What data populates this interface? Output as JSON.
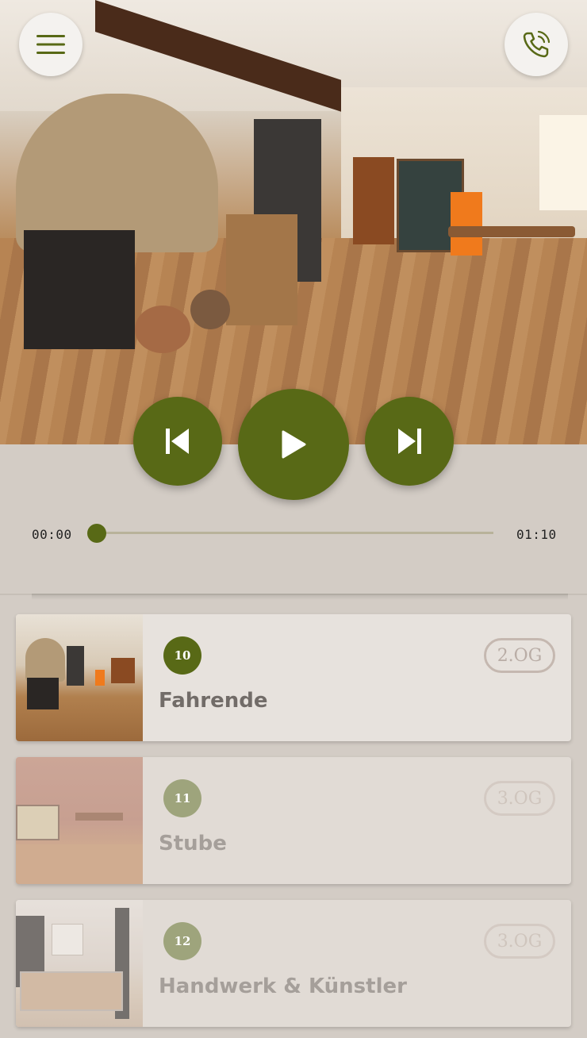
{
  "player": {
    "current_time": "00:00",
    "total_time": "01:10",
    "progress_fraction": 0.0
  },
  "stations": [
    {
      "number": "10",
      "title": "Fahrende",
      "floor": "2.OG",
      "active": true
    },
    {
      "number": "11",
      "title": "Stube",
      "floor": "3.OG",
      "active": false
    },
    {
      "number": "12",
      "title": "Handwerk & Künstler",
      "floor": "3.OG",
      "active": false
    }
  ],
  "colors": {
    "accent": "#586916",
    "accent_muted": "#9ea47c",
    "background": "#d3ccc5",
    "card_active": "#e7e2dd",
    "card_inactive": "#e1dbd5"
  },
  "icons": {
    "menu": "hamburger-menu-icon",
    "call": "phone-ringing-icon",
    "previous": "skip-previous-icon",
    "play": "play-icon",
    "next": "skip-next-icon"
  }
}
